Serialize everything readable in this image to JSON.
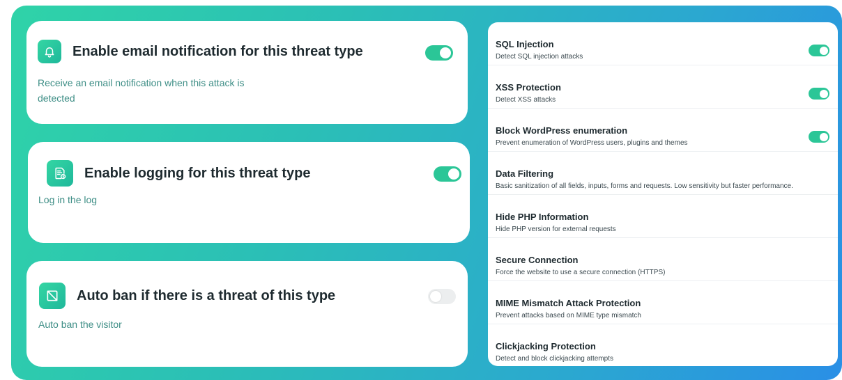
{
  "cards": [
    {
      "title": "Enable email notification for this threat type",
      "description": "Receive an email notification when this attack is detected",
      "icon": "bell-icon",
      "enabled": true
    },
    {
      "title": "Enable logging for this threat type",
      "description": "Log in the log",
      "icon": "log-file-icon",
      "enabled": true
    },
    {
      "title": "Auto ban if there is a threat of this type",
      "description": "Auto ban the visitor",
      "icon": "ban-icon",
      "enabled": false
    }
  ],
  "settings": [
    {
      "title": "SQL Injection",
      "description": "Detect SQL injection attacks",
      "enabled": true
    },
    {
      "title": "XSS Protection",
      "description": "Detect XSS attacks",
      "enabled": true
    },
    {
      "title": "Block WordPress enumeration",
      "description": "Prevent enumeration of WordPress users, plugins and themes",
      "enabled": true
    },
    {
      "title": "Data Filtering",
      "description": "Basic sanitization of all fields, inputs, forms and requests. Low sensitivity but faster performance."
    },
    {
      "title": "Hide PHP Information",
      "description": "Hide PHP version for external requests"
    },
    {
      "title": "Secure Connection",
      "description": "Force the website to use a secure connection (HTTPS)"
    },
    {
      "title": "MIME Mismatch Attack Protection",
      "description": "Prevent attacks based on MIME type mismatch"
    },
    {
      "title": "Clickjacking Protection",
      "description": "Detect and block clickjacking attempts"
    }
  ],
  "colors": {
    "accent": "#2bc697",
    "toggle_off": "#eceeef",
    "description_text": "#3e8e86"
  }
}
